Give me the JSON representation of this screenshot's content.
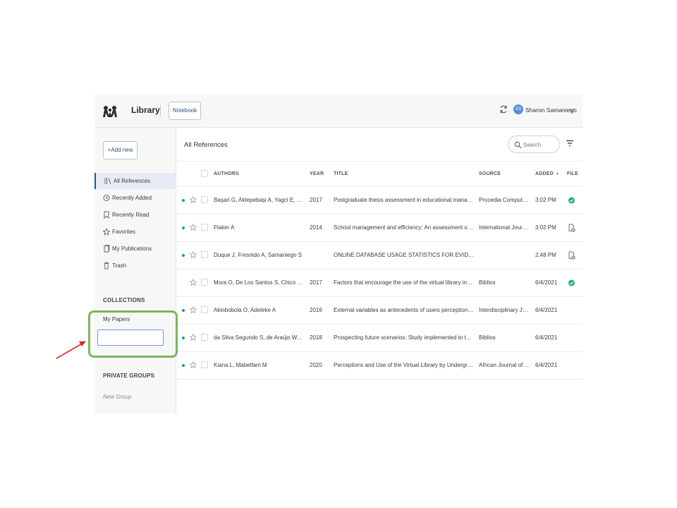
{
  "header": {
    "app_title": "Library",
    "notebook_label": "Notebook",
    "user_name": "Sharon Samaniego",
    "user_initials": "SS"
  },
  "sidebar": {
    "add_new_label": "+Add new",
    "items": [
      {
        "label": "All References",
        "icon": "library-icon",
        "active": true
      },
      {
        "label": "Recently Added",
        "icon": "clock-icon",
        "active": false
      },
      {
        "label": "Recently Read",
        "icon": "bookmark-icon",
        "active": false
      },
      {
        "label": "Favorites",
        "icon": "star-icon",
        "active": false
      },
      {
        "label": "My Publications",
        "icon": "publications-icon",
        "active": false
      },
      {
        "label": "Trash",
        "icon": "trash-icon",
        "active": false
      }
    ],
    "collections_heading": "COLLECTIONS",
    "collection_items": [
      "My Papers"
    ],
    "new_collection_value": "",
    "private_groups_heading": "PRIVATE GROUPS",
    "new_group_label": "New Group"
  },
  "main": {
    "title": "All References",
    "search_placeholder": "Search",
    "columns": {
      "authors": "AUTHORS",
      "year": "YEAR",
      "title": "TITLE",
      "source": "SOURCE",
      "added": "ADDED",
      "file": "FILE"
    },
    "rows": [
      {
        "unread": true,
        "authors": "Başari G, Aktepebaşi A, Yagci E, Akdag S",
        "year": "2017",
        "title": "Postgraduate thesis assessment in educational management s...",
        "source": "Procedia Computer S...",
        "added": "3:02 PM",
        "file": "check"
      },
      {
        "unread": true,
        "authors": "Flaker A",
        "year": "2014",
        "title": "School management and efficiency: An assessment of charter ...",
        "source": "International Journal ...",
        "added": "3:02 PM",
        "file": "attach"
      },
      {
        "unread": true,
        "authors": "Duque J, Fresnido A, Samaniego S",
        "year": "",
        "title": "ONLINE DATABASE USAGE STATISTICS FOR EVIDENCED-...",
        "source": "",
        "added": "2:48 PM",
        "file": "attach"
      },
      {
        "unread": false,
        "authors": "Mora O, De Los Santos S, Chico M, Me...",
        "year": "2017",
        "title": "Factors that encourage the use of the virtual library in college ...",
        "source": "Biblios",
        "added": "6/4/2021",
        "file": "check"
      },
      {
        "unread": true,
        "authors": "Akinbobola O, Adeleke A",
        "year": "2016",
        "title": "External variables as antecedents of users perception in virtual...",
        "source": "Interdisciplinary Jour...",
        "added": "6/4/2021",
        "file": ""
      },
      {
        "unread": true,
        "authors": "da Silva Segundo S, de Araújo W, Dias G",
        "year": "2018",
        "title": "Prospecting future scenarios: Study implemented to the virtual ...",
        "source": "Biblios",
        "added": "6/4/2021",
        "file": ""
      },
      {
        "unread": true,
        "authors": "Kiana L, Mabelfam M",
        "year": "2020",
        "title": "Perceptions and Use of the Virtual Library by Undergraduates ...",
        "source": "African Journal of Lib...",
        "added": "6/4/2021",
        "file": ""
      }
    ]
  },
  "colors": {
    "accent": "#2d4f86",
    "unread_dot": "#1aa36b",
    "file_check": "#1fa985",
    "highlight_box": "#7bb662",
    "arrow": "#d62a2a"
  }
}
